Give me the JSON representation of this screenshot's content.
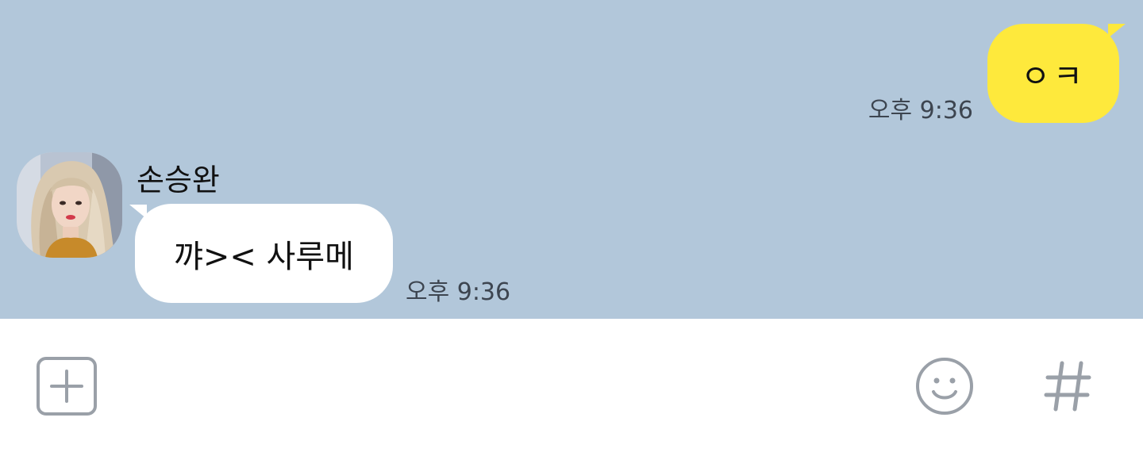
{
  "outgoing": {
    "text": "ㅇㅋ",
    "time": "오후 9:36",
    "bubble_color": "#fee93c"
  },
  "incoming": {
    "sender": "손승완",
    "text": "꺄>< 사루메",
    "time": "오후 9:36",
    "bubble_color": "#ffffff"
  },
  "chat": {
    "background_color": "#b2c7da"
  },
  "input_bar": {
    "plus_icon": "plus-square-icon",
    "emoji_icon": "smiley-icon",
    "hash_icon": "hash-icon",
    "icon_color": "#9aa0a8"
  }
}
